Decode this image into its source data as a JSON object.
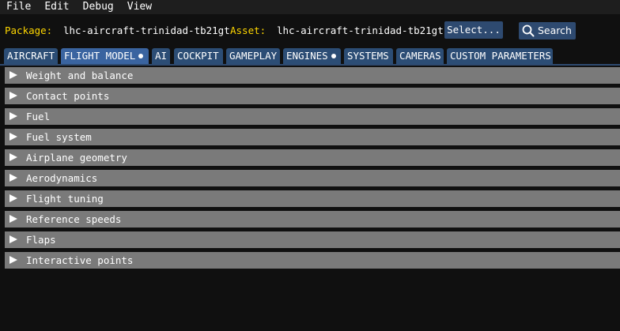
{
  "menu": [
    "File",
    "Edit",
    "Debug",
    "View"
  ],
  "package": {
    "package_label": "Package:",
    "package_value": "lhc-aircraft-trinidad-tb21gt",
    "asset_label": "Asset:",
    "asset_value": "lhc-aircraft-trinidad-tb21gt",
    "select_button": "Select...",
    "search_button": "Search"
  },
  "tabs": [
    {
      "label": "AIRCRAFT",
      "modified": false,
      "active": false
    },
    {
      "label": "FLIGHT MODEL",
      "modified": true,
      "active": true
    },
    {
      "label": "AI",
      "modified": false,
      "active": false
    },
    {
      "label": "COCKPIT",
      "modified": false,
      "active": false
    },
    {
      "label": "GAMEPLAY",
      "modified": false,
      "active": false
    },
    {
      "label": "ENGINES",
      "modified": true,
      "active": false
    },
    {
      "label": "SYSTEMS",
      "modified": false,
      "active": false
    },
    {
      "label": "CAMERAS",
      "modified": false,
      "active": false
    },
    {
      "label": "CUSTOM PARAMETERS",
      "modified": false,
      "active": false
    }
  ],
  "sections": [
    "Weight and balance",
    "Contact points",
    "Fuel",
    "Fuel system",
    "Airplane geometry",
    "Aerodynamics",
    "Flight tuning",
    "Reference speeds",
    "Flaps",
    "Interactive points"
  ],
  "colors": {
    "background": "#101010",
    "menubar": "#1e1e1e",
    "accent_button": "#2e4a70",
    "tab": "#2c4d75",
    "tab_active": "#3a64a0",
    "section_header": "#7a7a7a",
    "label_yellow": "#ffd700",
    "text": "#ffffff"
  },
  "icons": {
    "search": "magnifier-icon",
    "section_collapsed": "triangle-right-icon",
    "tab_modified": "dot-icon"
  }
}
